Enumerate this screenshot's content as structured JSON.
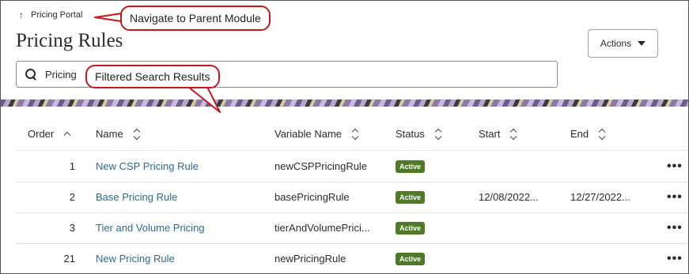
{
  "header": {
    "parent_link": "Pricing Portal",
    "page_title": "Pricing Rules",
    "actions_label": "Actions"
  },
  "search": {
    "value": "Pricing",
    "placeholder": ""
  },
  "callouts": {
    "parent": "Navigate to Parent Module",
    "search": "Filtered Search Results"
  },
  "columns": {
    "order": "Order",
    "name": "Name",
    "variable_name": "Variable Name",
    "status": "Status",
    "start": "Start",
    "end": "End"
  },
  "rows": [
    {
      "order": "1",
      "name": "New CSP Pricing Rule",
      "variable_name": "newCSPPricingRule",
      "status": "Active",
      "start": "",
      "end": ""
    },
    {
      "order": "2",
      "name": "Base Pricing Rule",
      "variable_name": "basePricingRule",
      "status": "Active",
      "start": "12/08/2022...",
      "end": "12/27/2022..."
    },
    {
      "order": "3",
      "name": "Tier and Volume Pricing",
      "variable_name": "tierAndVolumePrici...",
      "status": "Active",
      "start": "",
      "end": ""
    },
    {
      "order": "21",
      "name": "New Pricing Rule",
      "variable_name": "newPricingRule",
      "status": "Active",
      "start": "",
      "end": ""
    }
  ],
  "more_glyph": "•••",
  "colors": {
    "accent_link": "#2f6a8f",
    "status_active": "#4f7a28",
    "callout_border": "#c4161c"
  }
}
